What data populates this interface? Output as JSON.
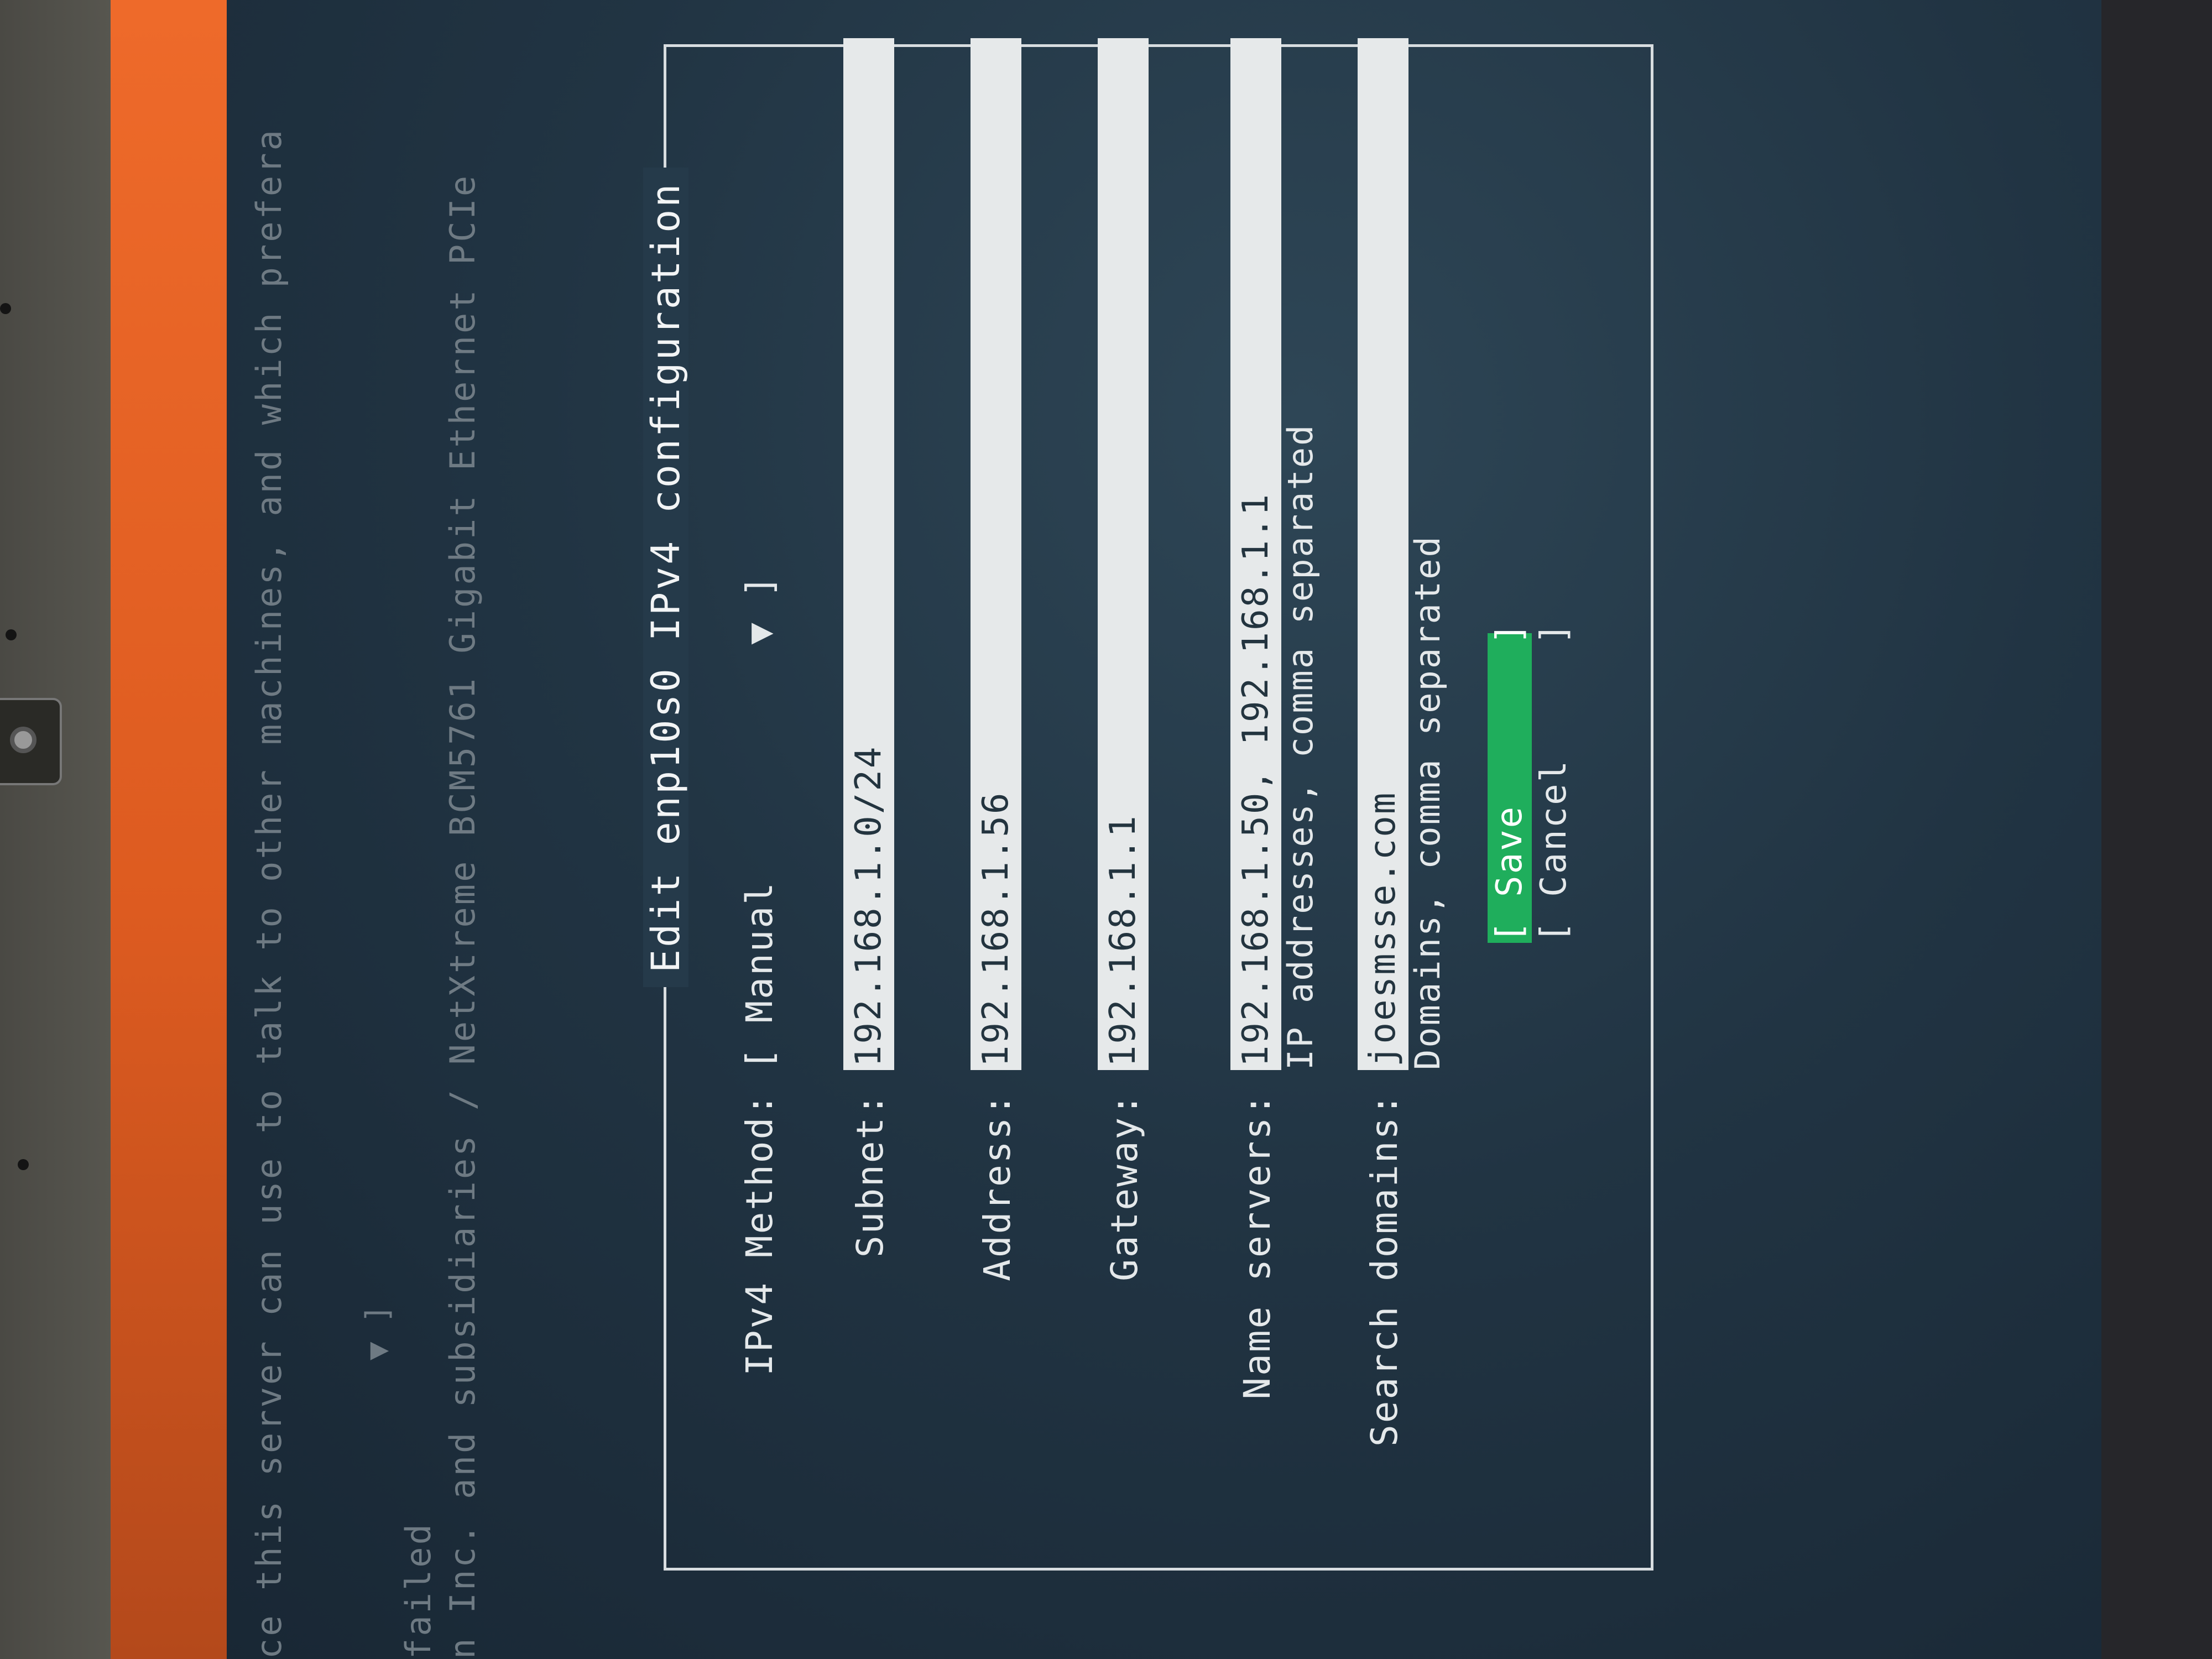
{
  "background": {
    "lines": [
      {
        "text": "ce this server can use to talk to other machines, and which prefera"
      },
      {
        "text": "failed"
      },
      {
        "text": "n Inc. and subsidiaries / NetXtreme BCM5761 Gigabit Ethernet PCIe"
      }
    ],
    "arrow": "▼ ]"
  },
  "dialog": {
    "title": "Edit enp10s0 IPv4 configuration",
    "method": {
      "label": "IPv4 Method:",
      "value": "[ Manual          ▼ ]"
    },
    "fields": {
      "subnet": {
        "label": "Subnet:",
        "value": "192.168.1.0/24"
      },
      "address": {
        "label": "Address:",
        "value": "192.168.1.56"
      },
      "gateway": {
        "label": "Gateway:",
        "value": "192.168.1.1"
      },
      "name_servers": {
        "label": "Name servers:",
        "value": "192.168.1.50, 192.168.1.1",
        "hint": "IP addresses, comma separated"
      },
      "search_domains": {
        "label": "Search domains:",
        "value": "joesmsse.com",
        "hint": "Domains, comma separated"
      }
    },
    "buttons": {
      "save": "[ Save       ]",
      "cancel": "[ Cancel     ]"
    }
  },
  "colors": {
    "header_orange": "#dd5b20",
    "save_green": "#1fae5c",
    "field_bg": "#e6e9ea"
  }
}
